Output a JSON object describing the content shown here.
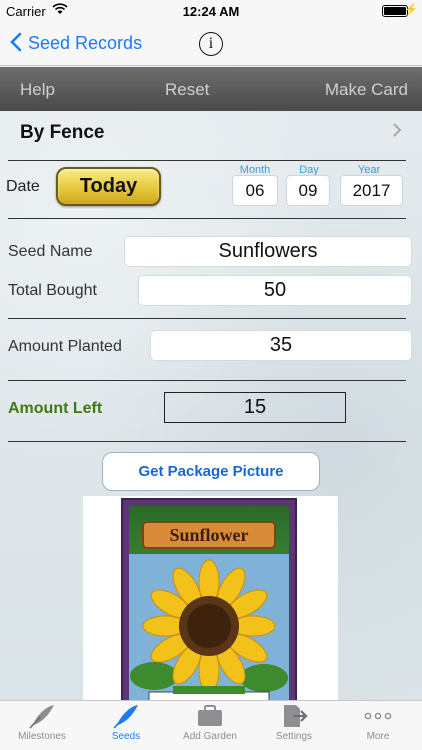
{
  "status_bar": {
    "carrier": "Carrier",
    "time": "12:24 AM"
  },
  "nav": {
    "back_label": "Seed Records",
    "info_glyph": "i"
  },
  "toolbar": {
    "help": "Help",
    "reset": "Reset",
    "make_card": "Make Card"
  },
  "garden": {
    "title": "By Fence"
  },
  "date": {
    "label": "Date",
    "today_button": "Today",
    "month_label": "Month",
    "month": "06",
    "day_label": "Day",
    "day": "09",
    "year_label": "Year",
    "year": "2017"
  },
  "seed": {
    "name_label": "Seed Name",
    "name": "Sunflowers",
    "bought_label": "Total Bought",
    "bought": "50",
    "planted_label": "Amount Planted",
    "planted": "35",
    "left_label": "Amount Left",
    "left": "15"
  },
  "package": {
    "button": "Get Package Picture",
    "card_title": "Sunflower"
  },
  "tabs": [
    {
      "label": "Milestones",
      "icon": "quill-icon"
    },
    {
      "label": "Seeds",
      "icon": "quill-icon"
    },
    {
      "label": "Add Garden",
      "icon": "briefcase-icon"
    },
    {
      "label": "Settings",
      "icon": "document-arrow-icon"
    },
    {
      "label": "More",
      "icon": "more-icon"
    }
  ],
  "colors": {
    "accent": "#1a7cf5",
    "amount_left": "#3d7a12",
    "today_button": "#e7c93a"
  }
}
